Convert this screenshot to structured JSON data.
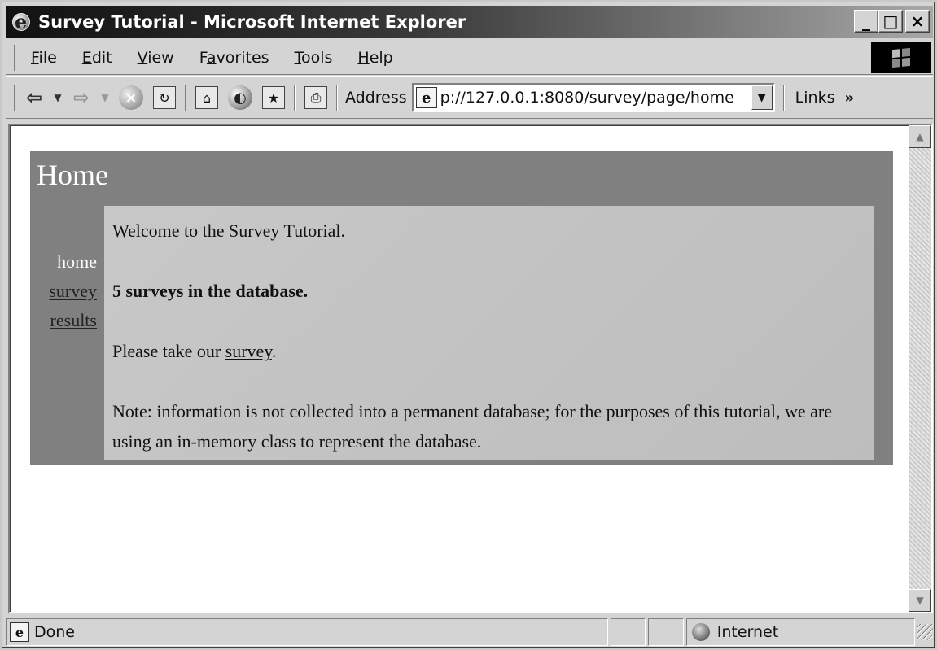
{
  "window": {
    "title": "Survey Tutorial - Microsoft Internet Explorer",
    "minimize": "_",
    "maximize": "□",
    "close": "×"
  },
  "menu": {
    "items": [
      {
        "key": "F",
        "rest": "ile"
      },
      {
        "key": "E",
        "rest": "dit"
      },
      {
        "key": "V",
        "rest": "iew"
      },
      {
        "pre": "F",
        "key": "a",
        "rest": "vorites"
      },
      {
        "key": "T",
        "rest": "ools"
      },
      {
        "key": "H",
        "rest": "elp"
      }
    ]
  },
  "toolbar": {
    "address_label": "Address",
    "address_value": "p://127.0.0.1:8080/survey/page/home",
    "links_label": "Links",
    "links_more": "»"
  },
  "page": {
    "title": "Home",
    "nav": {
      "home": "home",
      "survey": "survey",
      "results": "results"
    },
    "content": {
      "welcome": "Welcome to the Survey Tutorial.",
      "count": "5 surveys in the database.",
      "take_prefix": "Please take our ",
      "take_link": "survey",
      "take_suffix": ".",
      "note": "Note: information is not collected into a permanent database; for the purposes of this tutorial, we are using an in-memory class to represent the database."
    }
  },
  "status": {
    "text": "Done",
    "zone": "Internet"
  }
}
